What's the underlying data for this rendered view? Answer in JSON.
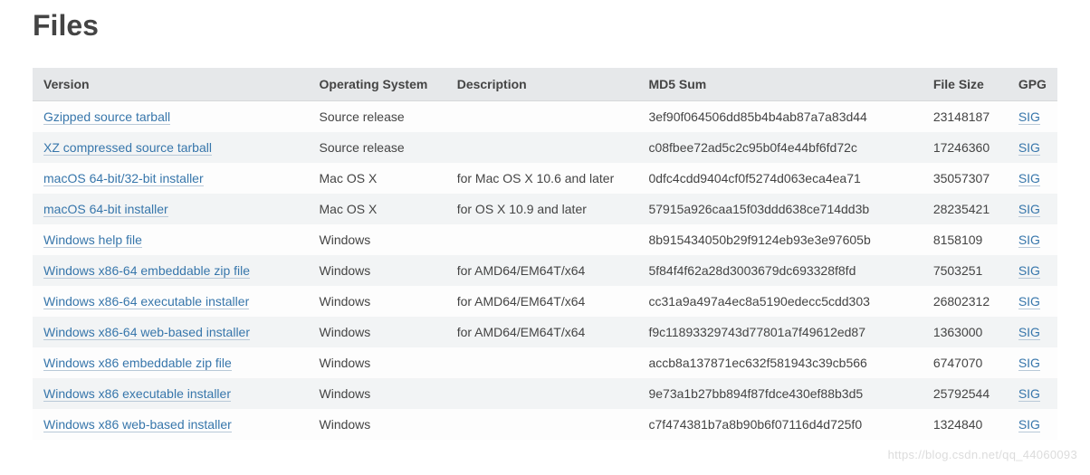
{
  "title": "Files",
  "columns": {
    "version": "Version",
    "os": "Operating System",
    "desc": "Description",
    "md5": "MD5 Sum",
    "size": "File Size",
    "gpg": "GPG"
  },
  "sig_label": "SIG",
  "rows": [
    {
      "version": "Gzipped source tarball",
      "os": "Source release",
      "desc": "",
      "md5": "3ef90f064506dd85b4b4ab87a7a83d44",
      "size": "23148187"
    },
    {
      "version": "XZ compressed source tarball",
      "os": "Source release",
      "desc": "",
      "md5": "c08fbee72ad5c2c95b0f4e44bf6fd72c",
      "size": "17246360"
    },
    {
      "version": "macOS 64-bit/32-bit installer",
      "os": "Mac OS X",
      "desc": "for Mac OS X 10.6 and later",
      "md5": "0dfc4cdd9404cf0f5274d063eca4ea71",
      "size": "35057307"
    },
    {
      "version": "macOS 64-bit installer",
      "os": "Mac OS X",
      "desc": "for OS X 10.9 and later",
      "md5": "57915a926caa15f03ddd638ce714dd3b",
      "size": "28235421"
    },
    {
      "version": "Windows help file",
      "os": "Windows",
      "desc": "",
      "md5": "8b915434050b29f9124eb93e3e97605b",
      "size": "8158109"
    },
    {
      "version": "Windows x86-64 embeddable zip file",
      "os": "Windows",
      "desc": "for AMD64/EM64T/x64",
      "md5": "5f84f4f62a28d3003679dc693328f8fd",
      "size": "7503251"
    },
    {
      "version": "Windows x86-64 executable installer",
      "os": "Windows",
      "desc": "for AMD64/EM64T/x64",
      "md5": "cc31a9a497a4ec8a5190edecc5cdd303",
      "size": "26802312"
    },
    {
      "version": "Windows x86-64 web-based installer",
      "os": "Windows",
      "desc": "for AMD64/EM64T/x64",
      "md5": "f9c11893329743d77801a7f49612ed87",
      "size": "1363000"
    },
    {
      "version": "Windows x86 embeddable zip file",
      "os": "Windows",
      "desc": "",
      "md5": "accb8a137871ec632f581943c39cb566",
      "size": "6747070"
    },
    {
      "version": "Windows x86 executable installer",
      "os": "Windows",
      "desc": "",
      "md5": "9e73a1b27bb894f87fdce430ef88b3d5",
      "size": "25792544"
    },
    {
      "version": "Windows x86 web-based installer",
      "os": "Windows",
      "desc": "",
      "md5": "c7f474381b7a8b90b6f07116d4d725f0",
      "size": "1324840"
    }
  ],
  "watermark": "https://blog.csdn.net/qq_44060093"
}
